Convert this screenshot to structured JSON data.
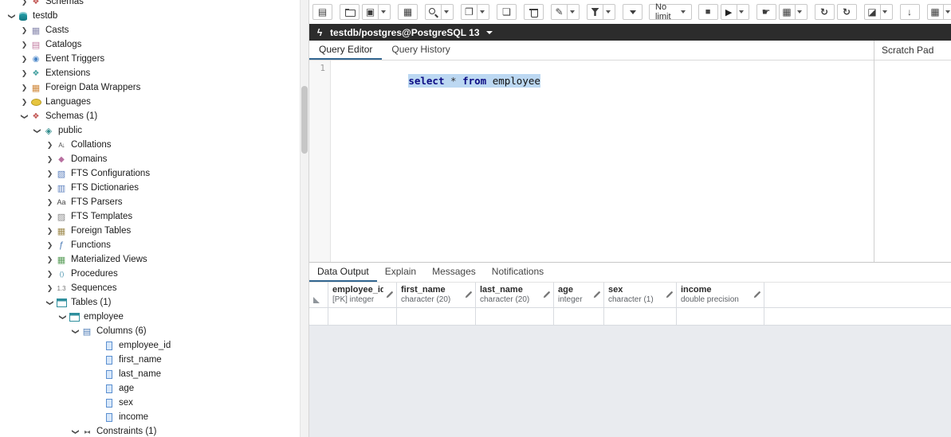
{
  "colors": {
    "accent": "#326690",
    "selection_bg": "#bcd8f2",
    "connection_bar_bg": "#2c2c2c"
  },
  "tree": {
    "items": [
      {
        "label": "Schemas",
        "level": 1,
        "chevron": "collapsed",
        "icon_class": "ti ti-schemas",
        "icon_name": "schemas-icon"
      },
      {
        "label": "testdb",
        "level": 0,
        "chevron": "expanded",
        "icon_class": "ti ti-db",
        "icon_name": "database-icon"
      },
      {
        "label": "Casts",
        "level": 1,
        "chevron": "collapsed",
        "icon_class": "ti ti-casts",
        "icon_name": "casts-icon"
      },
      {
        "label": "Catalogs",
        "level": 1,
        "chevron": "collapsed",
        "icon_class": "ti ti-catalogs",
        "icon_name": "catalogs-icon"
      },
      {
        "label": "Event Triggers",
        "level": 1,
        "chevron": "collapsed",
        "icon_class": "ti ti-event",
        "icon_name": "event-triggers-icon"
      },
      {
        "label": "Extensions",
        "level": 1,
        "chevron": "collapsed",
        "icon_class": "ti ti-ext",
        "icon_name": "extensions-icon"
      },
      {
        "label": "Foreign Data Wrappers",
        "level": 1,
        "chevron": "collapsed",
        "icon_class": "ti ti-fdw",
        "icon_name": "foreign-data-wrappers-icon"
      },
      {
        "label": "Languages",
        "level": 1,
        "chevron": "collapsed",
        "icon_class": "ti ti-lang",
        "icon_name": "languages-icon"
      },
      {
        "label": "Schemas (1)",
        "level": 1,
        "chevron": "expanded",
        "icon_class": "ti ti-schemas",
        "icon_name": "schemas-icon"
      },
      {
        "label": "public",
        "level": 2,
        "chevron": "expanded",
        "icon_class": "ti ti-schema",
        "icon_name": "schema-icon"
      },
      {
        "label": "Collations",
        "level": 3,
        "chevron": "collapsed",
        "icon_class": "ti ti-coll",
        "icon_name": "collations-icon"
      },
      {
        "label": "Domains",
        "level": 3,
        "chevron": "collapsed",
        "icon_class": "ti ti-domains",
        "icon_name": "domains-icon"
      },
      {
        "label": "FTS Configurations",
        "level": 3,
        "chevron": "collapsed",
        "icon_class": "ti ti-ftsc",
        "icon_name": "fts-configurations-icon"
      },
      {
        "label": "FTS Dictionaries",
        "level": 3,
        "chevron": "collapsed",
        "icon_class": "ti ti-ftsd",
        "icon_name": "fts-dictionaries-icon"
      },
      {
        "label": "FTS Parsers",
        "level": 3,
        "chevron": "collapsed",
        "icon_class": "ti ti-ftsp",
        "icon_name": "fts-parsers-icon"
      },
      {
        "label": "FTS Templates",
        "level": 3,
        "chevron": "collapsed",
        "icon_class": "ti ti-ftst",
        "icon_name": "fts-templates-icon"
      },
      {
        "label": "Foreign Tables",
        "level": 3,
        "chevron": "collapsed",
        "icon_class": "ti ti-ftables",
        "icon_name": "foreign-tables-icon"
      },
      {
        "label": "Functions",
        "level": 3,
        "chevron": "collapsed",
        "icon_class": "ti ti-func",
        "icon_name": "functions-icon"
      },
      {
        "label": "Materialized Views",
        "level": 3,
        "chevron": "collapsed",
        "icon_class": "ti ti-matv",
        "icon_name": "materialized-views-icon"
      },
      {
        "label": "Procedures",
        "level": 3,
        "chevron": "collapsed",
        "icon_class": "ti ti-proc",
        "icon_name": "procedures-icon"
      },
      {
        "label": "Sequences",
        "level": 3,
        "chevron": "collapsed",
        "icon_class": "ti ti-seq",
        "icon_name": "sequences-icon"
      },
      {
        "label": "Tables (1)",
        "level": 3,
        "chevron": "expanded",
        "icon_class": "ti ti-tables",
        "icon_name": "tables-icon"
      },
      {
        "label": "employee",
        "level": 4,
        "chevron": "expanded",
        "icon_class": "ti ti-table",
        "icon_name": "table-icon"
      },
      {
        "label": "Columns (6)",
        "level": 5,
        "chevron": "expanded",
        "icon_class": "ti ti-columns",
        "icon_name": "columns-icon"
      },
      {
        "label": "employee_id",
        "level": 6,
        "chevron": "none",
        "icon_class": "ti ti-column",
        "icon_name": "column-icon"
      },
      {
        "label": "first_name",
        "level": 6,
        "chevron": "none",
        "icon_class": "ti ti-column",
        "icon_name": "column-icon"
      },
      {
        "label": "last_name",
        "level": 6,
        "chevron": "none",
        "icon_class": "ti ti-column",
        "icon_name": "column-icon"
      },
      {
        "label": "age",
        "level": 6,
        "chevron": "none",
        "icon_class": "ti ti-column",
        "icon_name": "column-icon"
      },
      {
        "label": "sex",
        "level": 6,
        "chevron": "none",
        "icon_class": "ti ti-column",
        "icon_name": "column-icon"
      },
      {
        "label": "income",
        "level": 6,
        "chevron": "none",
        "icon_class": "ti ti-column",
        "icon_name": "column-icon"
      },
      {
        "label": "Constraints (1)",
        "level": 5,
        "chevron": "expanded",
        "icon_class": "ti ti-constraints",
        "icon_name": "constraints-icon"
      }
    ]
  },
  "toolbar": {
    "left_buttons": [
      {
        "name": "query-sections-button",
        "icon": "rows-icon"
      },
      {
        "name": "open-file-button",
        "icon": "folder-icon",
        "gap": true
      },
      {
        "name": "save-file-button",
        "icon": "save-icon",
        "dropdown": true
      },
      {
        "name": "view-data-button",
        "icon": "table-icon",
        "gap": true
      },
      {
        "name": "find-button",
        "icon": "search-icon",
        "dropdown": true,
        "gap": true
      },
      {
        "name": "copy-button",
        "icon": "copy-icon",
        "dropdown": true,
        "gap": true
      },
      {
        "name": "paste-button",
        "icon": "paste-icon",
        "gap": true
      },
      {
        "name": "delete-button",
        "icon": "trash-icon",
        "gap": true
      },
      {
        "name": "edit-button",
        "icon": "pencil-icon",
        "dropdown": true,
        "gap": true
      },
      {
        "name": "filter-button",
        "icon": "filter-icon",
        "dropdown": true,
        "gap": true
      },
      {
        "name": "filter-options-button",
        "icon": "chevron-down-icon",
        "gap": true
      }
    ],
    "limit_label": "No limit",
    "right_buttons": [
      {
        "name": "cancel-query-button",
        "icon": "stop-icon"
      },
      {
        "name": "execute-button",
        "icon": "play-icon",
        "dropdown": true
      },
      {
        "name": "commit-button",
        "icon": "hand-icon",
        "gap": true
      },
      {
        "name": "rollback-button",
        "icon": "grid-icon",
        "dropdown": true
      },
      {
        "name": "fetch-prev-button",
        "icon": "sync-icon",
        "gap": true
      },
      {
        "name": "fetch-next-button",
        "icon": "sync-icon"
      },
      {
        "name": "clear-button",
        "icon": "eraser-icon",
        "dropdown": true,
        "gap": true
      },
      {
        "name": "download-button",
        "icon": "download-icon",
        "gap": true
      },
      {
        "name": "macro-button",
        "icon": "macro-icon",
        "dropdown": true,
        "gap": true
      }
    ]
  },
  "connection": {
    "label": "testdb/postgres@PostgreSQL 13"
  },
  "editor": {
    "tabs": [
      {
        "label": "Query Editor",
        "active": true
      },
      {
        "label": "Query History",
        "active": false
      }
    ],
    "line_number": "1",
    "tokens": [
      {
        "text": "select ",
        "type": "keyword"
      },
      {
        "text": "* ",
        "type": "operator"
      },
      {
        "text": "from ",
        "type": "keyword"
      },
      {
        "text": "employee",
        "type": "identifier"
      }
    ]
  },
  "scratch_pad": {
    "title": "Scratch Pad"
  },
  "output": {
    "tabs": [
      {
        "label": "Data Output",
        "active": true
      },
      {
        "label": "Explain",
        "active": false
      },
      {
        "label": "Messages",
        "active": false
      },
      {
        "label": "Notifications",
        "active": false
      }
    ],
    "grid": {
      "columns": [
        {
          "name": "employee_id",
          "type": "[PK] integer"
        },
        {
          "name": "first_name",
          "type": "character (20)"
        },
        {
          "name": "last_name",
          "type": "character (20)"
        },
        {
          "name": "age",
          "type": "integer"
        },
        {
          "name": "sex",
          "type": "character (1)"
        },
        {
          "name": "income",
          "type": "double precision"
        }
      ]
    }
  }
}
